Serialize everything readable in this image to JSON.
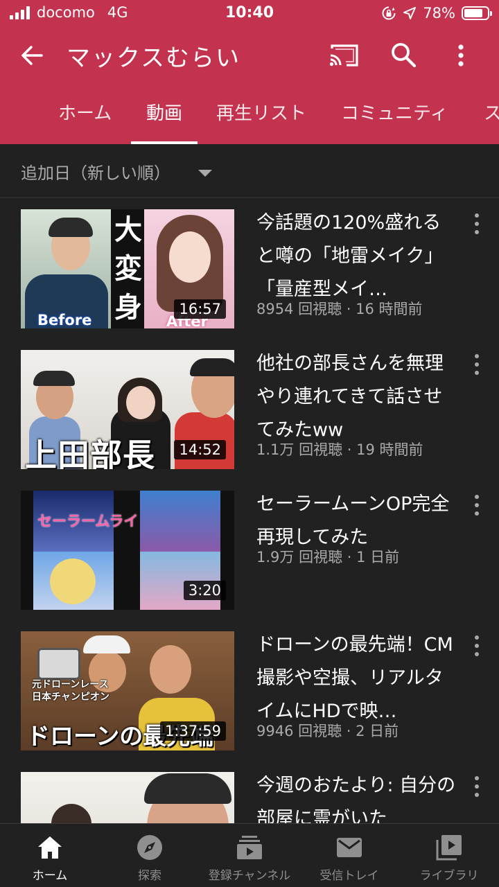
{
  "status_bar": {
    "carrier": "docomo",
    "network": "4G",
    "time": "10:40",
    "battery": "78%",
    "battery_level": 0.78
  },
  "app_bar": {
    "title": "マックスむらい",
    "icons": [
      "back-arrow-icon",
      "cast-icon",
      "search-icon",
      "more-vertical-icon"
    ]
  },
  "tabs": [
    {
      "label": "ホーム",
      "active": false
    },
    {
      "label": "動画",
      "active": true
    },
    {
      "label": "再生リスト",
      "active": false
    },
    {
      "label": "コミュニティ",
      "active": false
    },
    {
      "label": "ス",
      "active": false
    }
  ],
  "sort": {
    "label": "追加日（新しい順）"
  },
  "videos": [
    {
      "title": "今話題の120%盛れると噂の「地雷メイク」「量産型メイ…",
      "meta": "8954 回視聴 · 16 時間前",
      "duration": "16:57",
      "thumb_text": {
        "kanji": "大変身",
        "before": "Before",
        "after": "After"
      }
    },
    {
      "title": "他社の部長さんを無理やり連れてきて話させてみたww",
      "meta": "1.1万 回視聴 · 19 時間前",
      "duration": "14:52",
      "thumb_text": {
        "caption": "上田部長"
      }
    },
    {
      "title": "セーラームーンOP完全再現してみた",
      "meta": "1.9万 回視聴 · 1 日前",
      "duration": "3:20",
      "thumb_text": {
        "logo": "セーラームライ"
      }
    },
    {
      "title": "ドローンの最先端！CM撮影や空撮、リアルタイムにHDで映…",
      "meta": "9946 回視聴 · 2 日前",
      "duration": "1:37:59",
      "thumb_text": {
        "small_1": "元ドローンレース",
        "small_2": "日本チャンピオン",
        "caption": "ドローンの最先端"
      }
    },
    {
      "title": "今週のおたより: 自分の部屋に霊がいた",
      "meta": "",
      "duration": ""
    }
  ],
  "bottom_nav": [
    {
      "label": "ホーム",
      "icon": "home-icon",
      "active": true
    },
    {
      "label": "探索",
      "icon": "explore-compass-icon",
      "active": false
    },
    {
      "label": "登録チャンネル",
      "icon": "subscriptions-icon",
      "active": false
    },
    {
      "label": "受信トレイ",
      "icon": "inbox-mail-icon",
      "active": false
    },
    {
      "label": "ライブラリ",
      "icon": "library-icon",
      "active": false
    }
  ],
  "colors": {
    "header": "#c3334f",
    "background": "#212121",
    "secondary_text": "#aaaaaa"
  }
}
